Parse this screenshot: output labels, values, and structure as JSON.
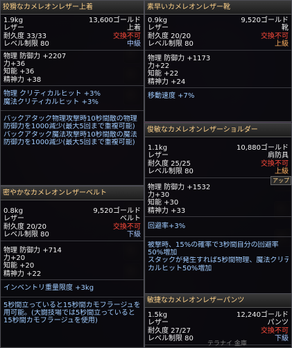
{
  "tooltips": [
    {
      "id": "jacket",
      "title": "狡猾なカメレオンレザー上着",
      "weight": "1.9kg",
      "price": "13,600ゴールド",
      "material": "レザー",
      "slot": "上着",
      "durability": "耐久度 33/33",
      "trade": "交換不可",
      "level": "レベル制限 80",
      "grade": "中級",
      "stats": [
        "物理 防御力 +2207",
        "力+36",
        "知能 +36",
        "精神力 +38"
      ],
      "bonuses": [
        "物理 クリティカルヒット +3%",
        "魔法クリティカルヒット +3%"
      ],
      "desc": [
        "バックアタック物理攻撃時10秒間敵の物理",
        "防御力を1000減少(最大5回まで重複可能)",
        "バックアタック魔法攻撃時10秒間敵の魔法",
        "防御力を1000減少(最大5回まで重複可能)"
      ]
    },
    {
      "id": "shoes",
      "title": "素早いカメレオンレザー靴",
      "weight": "0.9kg",
      "price": "9,520ゴールド",
      "material": "レザー",
      "slot": "靴",
      "durability": "耐久度 20/20",
      "trade": "交換不可",
      "level": "レベル制限 80",
      "grade": "上級",
      "stats": [
        "物理 防御力 +1173",
        "力+22",
        "知能 +22",
        "精神力 +24"
      ],
      "bonuses": [
        "移動速度 +7%"
      ]
    },
    {
      "id": "shoulder",
      "title": "俊敏なカメレオンレザーショルダー",
      "weight": "1.1kg",
      "price": "10,880ゴールド",
      "material": "レザー",
      "slot": "肩防具",
      "durability": "耐久度 25/25",
      "trade": "交換不可",
      "level": "レベル制限 80",
      "grade": "上級",
      "stats": [
        "物理 防御力 +1532",
        "力+30",
        "知能 +30",
        "精神力 +33"
      ],
      "bonuses": [
        "回避率+3%"
      ],
      "desc": [
        "被撃時、15%の確率で3秒間自分の回避率",
        "50%増加",
        "スタックが発生すれば5秒間物理、魔法クリティ",
        "カルヒット50%増加"
      ]
    },
    {
      "id": "belt",
      "title": "密やかなカメレオンレザーベルト",
      "weight": "0.8kg",
      "price": "9,520ゴールド",
      "material": "レザー",
      "slot": "ベルト",
      "durability": "耐久度 20/20",
      "trade": "交換不可",
      "level": "レベル制限 80",
      "grade": "下級",
      "stats": [
        "物理 防御力 +714",
        "力+20",
        "知能 +20",
        "精神力 +22"
      ],
      "bonuses": [
        "インベントリ重量限度 +3kg"
      ],
      "desc": [
        "5秒間立っていると15秒間カモフラージュを使",
        "用可能。(大闘技場では5秒間立っていると",
        "15秒間カモフラージュを使用)"
      ]
    },
    {
      "id": "pants",
      "title": "敏捷なカメレオンレザーパンツ",
      "weight": "1.5kg",
      "price": "12,240ゴールド",
      "material": "レザー",
      "slot": "パンツ",
      "durability": "耐久度 27/27",
      "trade": "交換不可",
      "level": "レベル制限 80",
      "grade": "下級"
    }
  ],
  "badge": "アップ",
  "pants_overlay_text": "テラナイ 金庫"
}
